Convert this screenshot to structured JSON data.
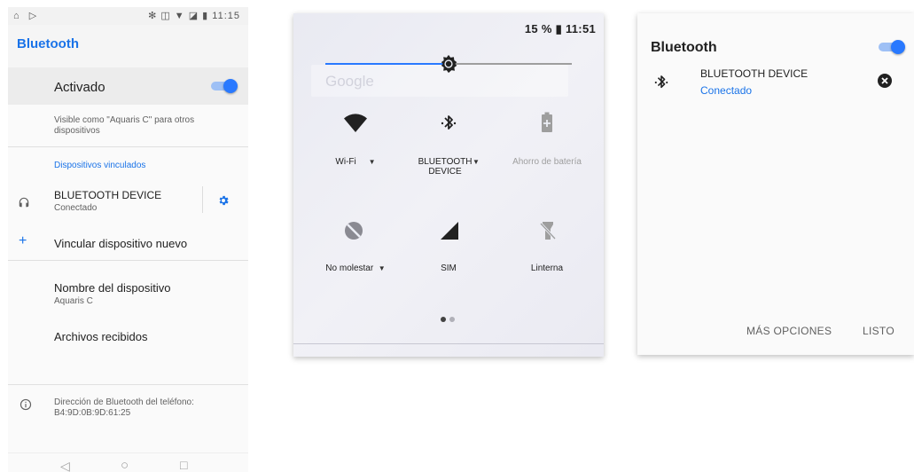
{
  "settings": {
    "status_left": "⌂ ▷",
    "status_right": "✻ ◫ ▼ ◪ ▮ 11:15",
    "title": "Bluetooth",
    "activado_label": "Activado",
    "visible_text": "Visible como \"Aquaris C\" para otros dispositivos",
    "paired_header": "Dispositivos vinculados",
    "device_name": "BLUETOOTH DEVICE",
    "device_status": "Conectado",
    "pair_new_label": "Vincular dispositivo nuevo",
    "device_name_label": "Nombre del dispositivo",
    "device_name_value": "Aquaris C",
    "received_files_label": "Archivos recibidos",
    "bt_address_text": "Dirección de Bluetooth del teléfono: B4:9D:0B:9D:61:25"
  },
  "quick_settings": {
    "battery_text": "15 % ▮ 11:51",
    "brightness_level": 0.5,
    "ghost_search_text": "Google",
    "tiles": [
      {
        "label": "Wi-Fi",
        "icon": "wifi-icon",
        "dropdown": true,
        "enabled": true
      },
      {
        "label": "BLUETOOTH DEVICE",
        "icon": "bluetooth-icon",
        "dropdown": true,
        "enabled": true
      },
      {
        "label": "Ahorro de batería",
        "icon": "battery-saver-icon",
        "dropdown": false,
        "enabled": false
      },
      {
        "label": "No molestar",
        "icon": "do-not-disturb-icon",
        "dropdown": true,
        "enabled": false
      },
      {
        "label": "SIM",
        "icon": "cellular-signal-icon",
        "dropdown": false,
        "enabled": true
      },
      {
        "label": "Linterna",
        "icon": "flashlight-off-icon",
        "dropdown": false,
        "enabled": false
      }
    ],
    "page_count": 2,
    "current_page": 1
  },
  "dialog": {
    "title": "Bluetooth",
    "device_name": "BLUETOOTH DEVICE",
    "device_status": "Conectado",
    "more_options_label": "MÁS OPCIONES",
    "done_label": "LISTO"
  },
  "colors": {
    "accent": "#2979ff",
    "link_blue": "#1a73e8"
  }
}
